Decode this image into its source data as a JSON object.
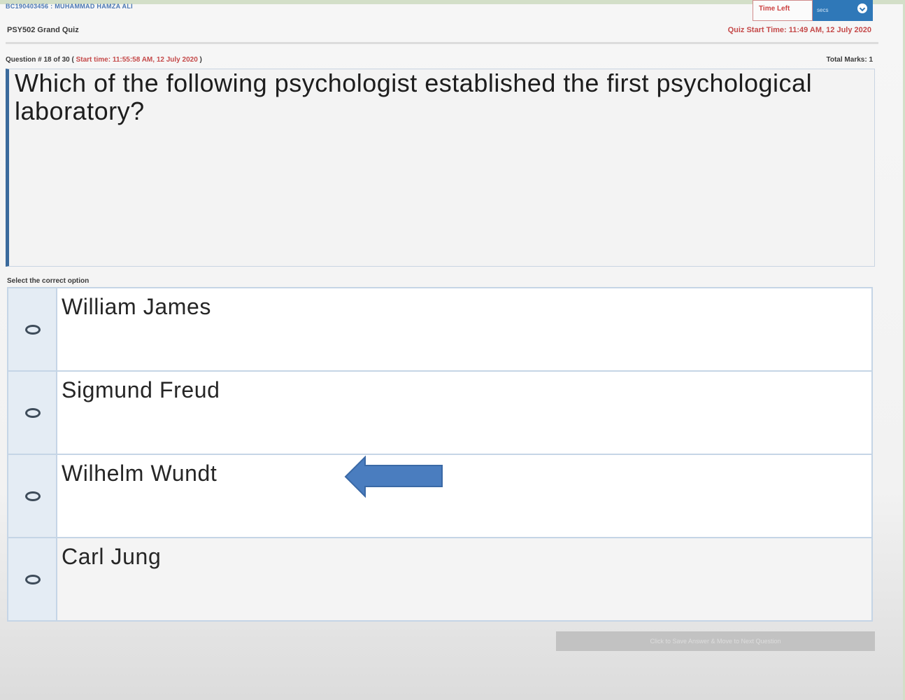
{
  "header": {
    "student_line": "BC190403456 : MUHAMMAD HAMZA ALI",
    "course": "PSY502 Grand Quiz",
    "quiz_start": "Quiz Start Time: 11:49 AM, 12 July 2020",
    "timer_label": "Time Left",
    "timer_value": "secs"
  },
  "question": {
    "meta": "Question # 18 of 30 ( ",
    "start_time": "Start time: 11:55:58 AM, 12 July 2020",
    "meta_end": " )",
    "total_marks": "Total Marks: 1",
    "text": "Which of the following psychologist established the first psychological laboratory?"
  },
  "options": {
    "prompt": "Select the correct option",
    "items": [
      {
        "label": "William James"
      },
      {
        "label": "Sigmund Freud"
      },
      {
        "label": "Wilhelm Wundt"
      },
      {
        "label": "Carl Jung"
      }
    ]
  },
  "footer": {
    "save_label": "Click to Save Answer & Move to Next Question"
  },
  "colors": {
    "accent": "#2f78b8",
    "arrow": "#4a7dbf"
  },
  "icons": [
    "radio-icon",
    "pointer-arrow-icon",
    "chevron-down-icon"
  ]
}
